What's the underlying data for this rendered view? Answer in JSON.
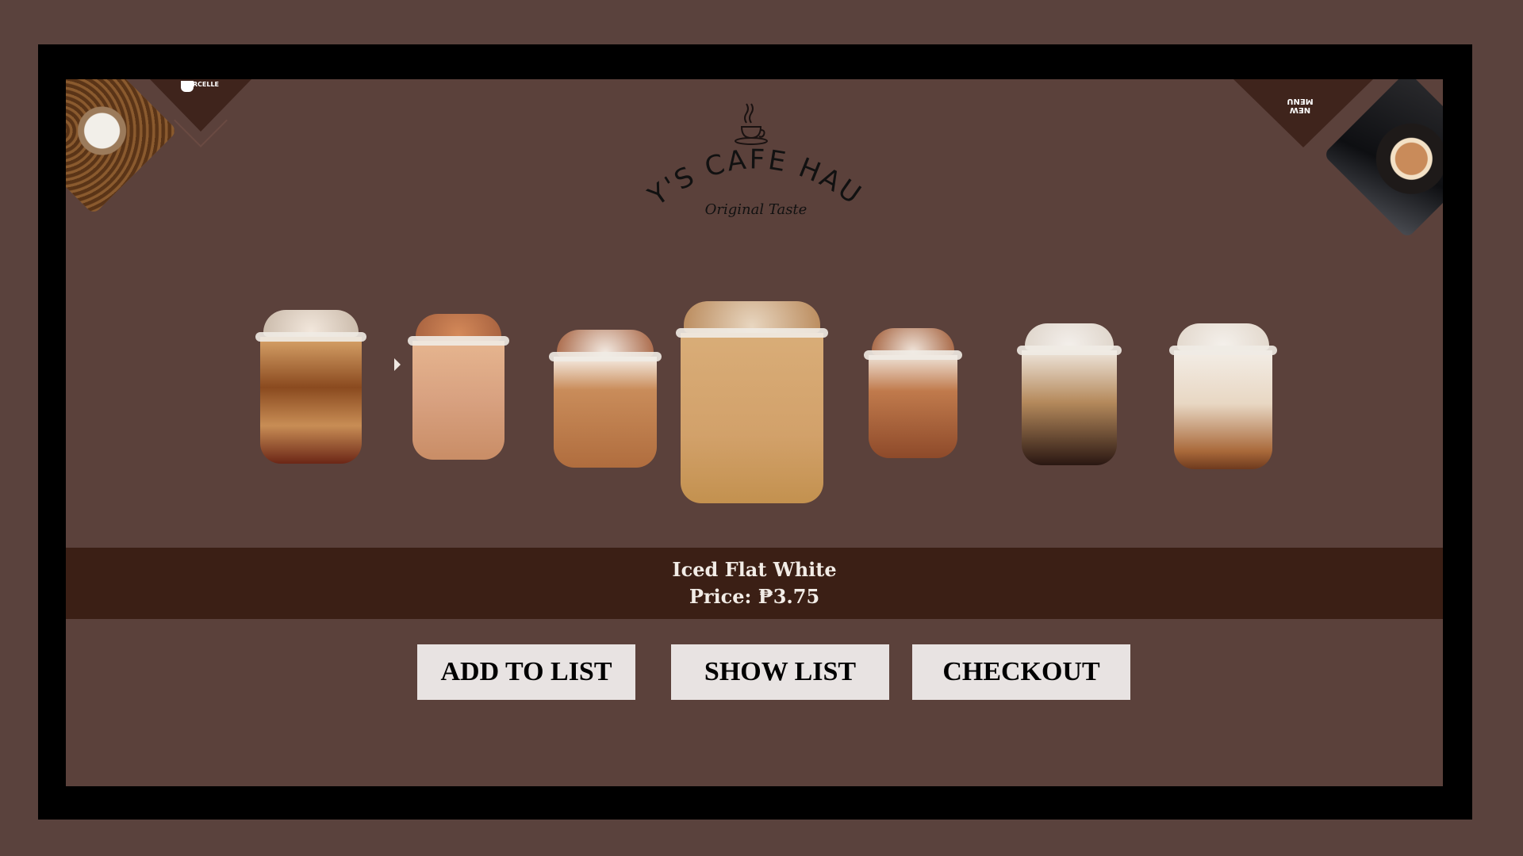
{
  "brand": {
    "badge_label": "BORCELLE",
    "corner_tag": "NEW MENU"
  },
  "logo": {
    "title": "AY'S CAFE HAUS",
    "tagline": "Original Taste"
  },
  "selected_item": {
    "name": "Iced Flat White",
    "price": "Price: ₱3.75"
  },
  "actions": {
    "add_label": "ADD TO LIST",
    "show_label": "SHOW LIST",
    "checkout_label": "CHECKOUT"
  },
  "menu_items": [
    {
      "icon": "iced-caramel-macchiato-icon"
    },
    {
      "icon": "iced-latte-icon"
    },
    {
      "icon": "iced-mocha-whipped-icon"
    },
    {
      "icon": "iced-flat-white-icon"
    },
    {
      "icon": "iced-cocoa-whipped-icon"
    },
    {
      "icon": "iced-americano-cream-icon"
    },
    {
      "icon": "iced-caramel-cream-icon"
    }
  ],
  "colors": {
    "page_bg": "#5a423d",
    "frame": "#000000",
    "caption_bar": "#3b1f15",
    "button_bg": "#e8e3e2"
  }
}
